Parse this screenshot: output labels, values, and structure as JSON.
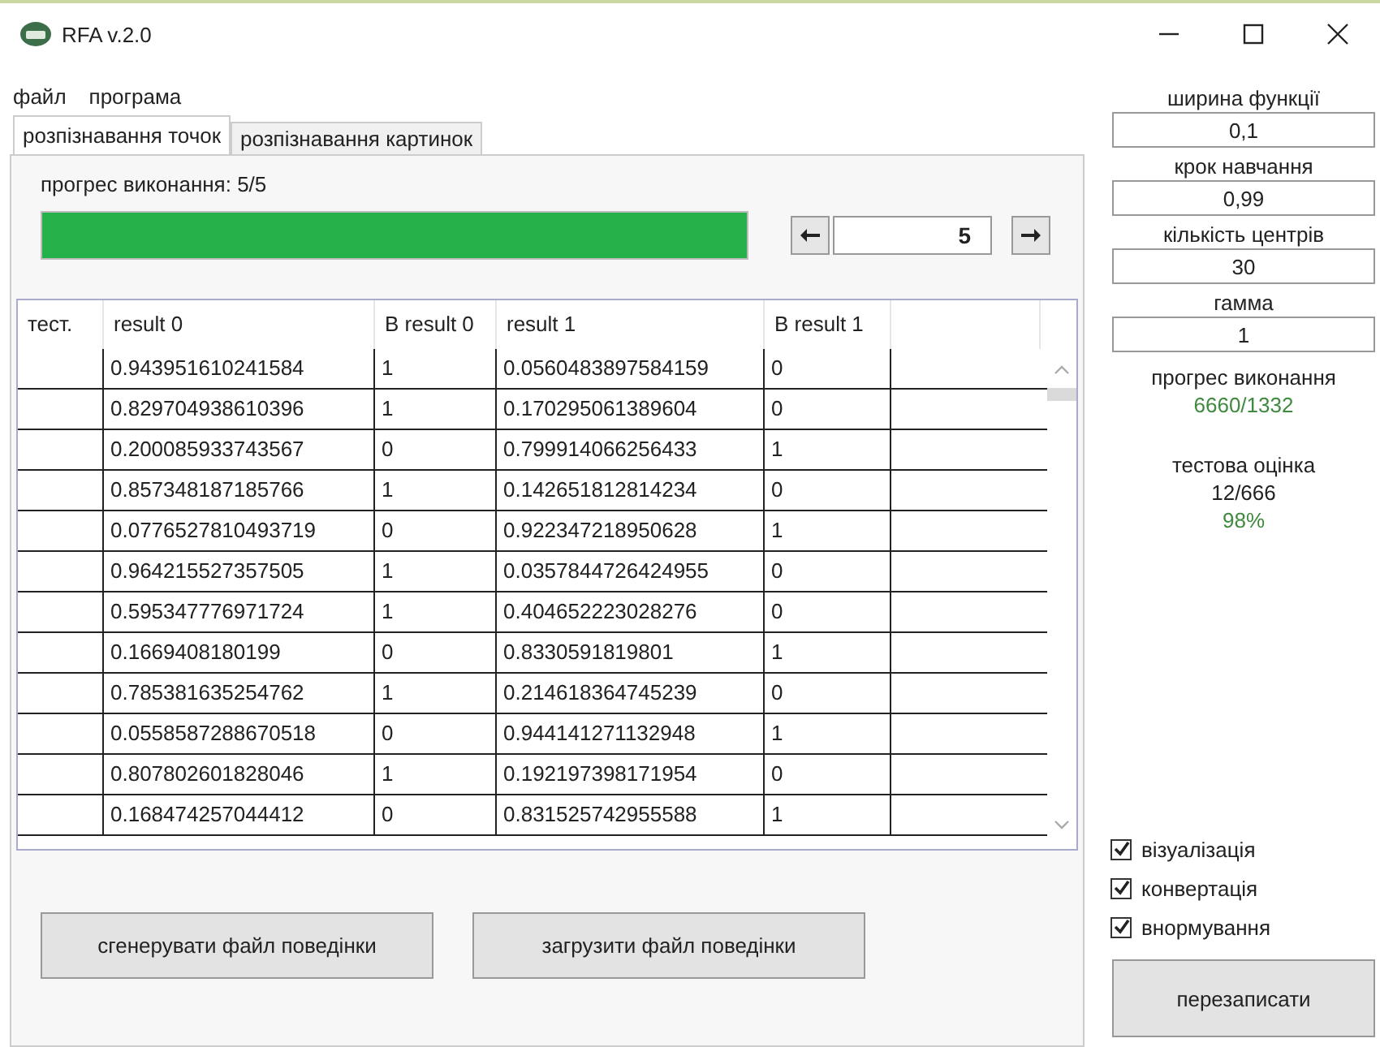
{
  "window": {
    "title": "RFA v.2.0"
  },
  "menu": [
    "файл",
    "програма"
  ],
  "tabs": [
    {
      "label": "розпізнавання точок",
      "selected": true
    },
    {
      "label": "розпізнавання картинок",
      "selected": false
    }
  ],
  "progress": {
    "label": "прогрес виконання: 5/5",
    "level": 1
  },
  "navigator": {
    "value": "5"
  },
  "table": {
    "columns": [
      "тест.",
      "result 0",
      "B result 0",
      "result 1",
      "B result 1"
    ],
    "rows": [
      [
        "",
        "0.943951610241584",
        "1",
        "0.0560483897584159",
        "0"
      ],
      [
        "",
        "0.829704938610396",
        "1",
        "0.170295061389604",
        "0"
      ],
      [
        "",
        "0.200085933743567",
        "0",
        "0.799914066256433",
        "1"
      ],
      [
        "",
        "0.857348187185766",
        "1",
        "0.142651812814234",
        "0"
      ],
      [
        "",
        "0.0776527810493719",
        "0",
        "0.922347218950628",
        "1"
      ],
      [
        "",
        "0.964215527357505",
        "1",
        "0.0357844726424955",
        "0"
      ],
      [
        "",
        "0.595347776971724",
        "1",
        "0.404652223028276",
        "0"
      ],
      [
        "",
        "0.1669408180199",
        "0",
        "0.8330591819801",
        "1"
      ],
      [
        "",
        "0.785381635254762",
        "1",
        "0.214618364745239",
        "0"
      ],
      [
        "",
        "0.0558587288670518",
        "0",
        "0.944141271132948",
        "1"
      ],
      [
        "",
        "0.807802601828046",
        "1",
        "0.192197398171954",
        "0"
      ],
      [
        "",
        "0.168474257044412",
        "0",
        "0.831525742955588",
        "1"
      ]
    ]
  },
  "buttons": [
    "сгенерувати файл поведінки",
    "загрузити файл поведінки"
  ],
  "settings": [
    {
      "label": "ширина функції",
      "value": "0,1"
    },
    {
      "label": "крок навчання",
      "value": "0,99"
    },
    {
      "label": "кількість центрів",
      "value": "30"
    },
    {
      "label": "гамма",
      "value": "1"
    }
  ],
  "training_progress": {
    "label": "прогрес виконання",
    "value": "6660/1332"
  },
  "test_score": {
    "label": "тестова оцінка",
    "value": "12/666",
    "percent": "98%"
  },
  "options": [
    {
      "label": "візуалізація",
      "checked": true
    },
    {
      "label": "конвертація",
      "checked": true
    },
    {
      "label": "внормування",
      "checked": true
    }
  ],
  "rewrite_button": "перезаписати"
}
